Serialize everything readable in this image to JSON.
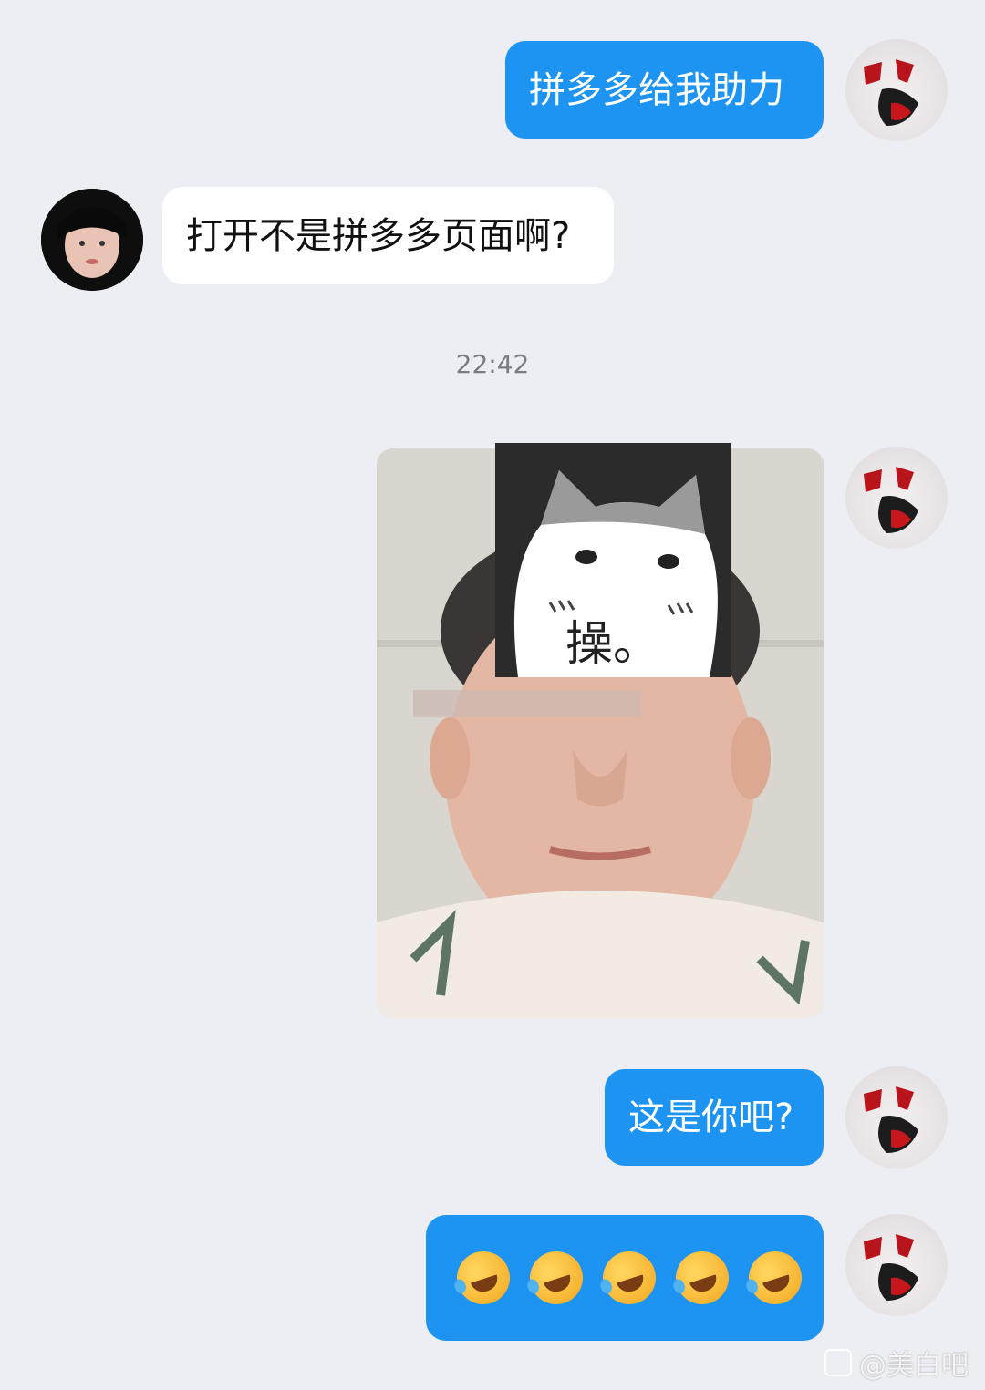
{
  "messages": [
    {
      "from": "me",
      "text": "拼多多给我助力"
    },
    {
      "from": "other",
      "text": "打开不是拼多多页面啊?"
    },
    {
      "from": "me",
      "type": "image",
      "overlay_text": "操。"
    },
    {
      "from": "me",
      "text": "这是你吧?"
    },
    {
      "from": "me",
      "type": "emoji",
      "emoji_icon": "rolling-on-floor-laughing-icon",
      "emoji_count": 5
    }
  ],
  "timestamp": "22:42",
  "colors": {
    "outgoing_bubble": "#1e94f2",
    "incoming_bubble": "#ffffff",
    "background": "#ededf4"
  },
  "watermark": {
    "text": "@美白吧"
  }
}
